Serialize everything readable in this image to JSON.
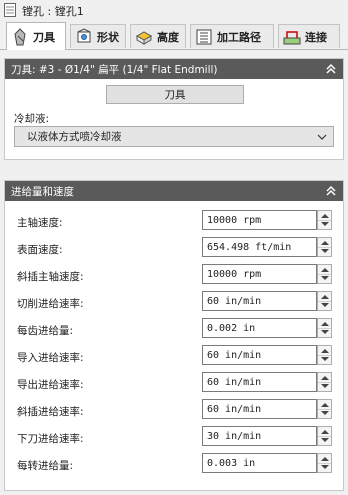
{
  "window": {
    "title": "镗孔 : 镗孔1",
    "icon": "document-icon"
  },
  "tabs": [
    {
      "label": "刀具",
      "icon": "tool-icon",
      "active": true
    },
    {
      "label": "形状",
      "icon": "shape-icon",
      "active": false
    },
    {
      "label": "高度",
      "icon": "height-icon",
      "active": false
    },
    {
      "label": "加工路径",
      "icon": "passes-icon",
      "active": false
    },
    {
      "label": "连接",
      "icon": "linking-icon",
      "active": false
    }
  ],
  "tool_panel": {
    "header": "刀具: #3 - Ø1/4\" 扁平 (1/4\" Flat Endmill)",
    "tool_button": "刀具",
    "coolant_label": "冷却液:",
    "coolant_value": "以液体方式喷冷却液"
  },
  "feed_panel": {
    "header": "进给量和速度",
    "rows": [
      {
        "label": "主轴速度:",
        "value": "10000 rpm"
      },
      {
        "label": "表面速度:",
        "value": "654.498 ft/min"
      },
      {
        "label": "斜插主轴速度:",
        "value": "10000 rpm"
      },
      {
        "label": "切削进给速率:",
        "value": "60 in/min"
      },
      {
        "label": "每齿进给量:",
        "value": "0.002 in"
      },
      {
        "label": "导入进给速率:",
        "value": "60 in/min"
      },
      {
        "label": "导出进给速率:",
        "value": "60 in/min"
      },
      {
        "label": "斜插进给速率:",
        "value": "60 in/min"
      },
      {
        "label": "下刀进给速率:",
        "value": "30 in/min"
      },
      {
        "label": "每转进给量:",
        "value": "0.003 in"
      }
    ]
  },
  "colors": {
    "panel_header": "#5a5a5a",
    "panel_text": "#ffffff",
    "background": "#f0f0f0"
  }
}
